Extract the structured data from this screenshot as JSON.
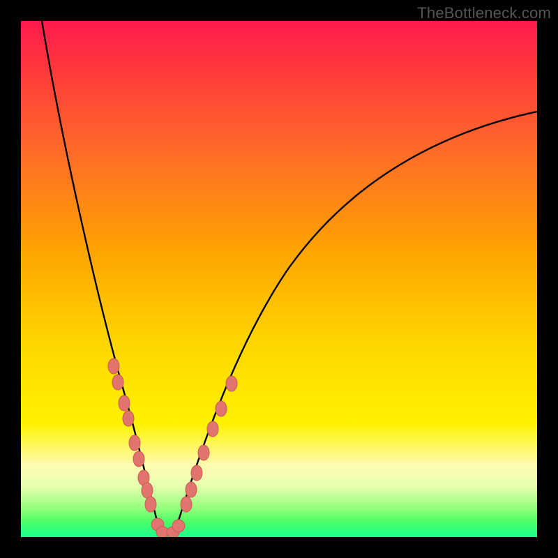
{
  "watermark": "TheBottleneck.com",
  "colors": {
    "background": "#000000",
    "gradient_top": "#ff1a4d",
    "gradient_bottom": "#1aff8c",
    "curve": "#000000",
    "marker_fill": "#e2746e",
    "marker_stroke": "#b84a44"
  },
  "chart_data": {
    "type": "line",
    "title": "",
    "xlabel": "",
    "ylabel": "",
    "xlim": [
      0,
      100
    ],
    "ylim": [
      0,
      100
    ],
    "grid": false,
    "legend": false,
    "note": "Axes are unlabeled; values are normalized 0–100. y is a bottleneck-percentage-like quantity (0 at bottom/green, 100 at top/red). The visible curve is V-shaped with its minimum near x≈27 at y≈0.",
    "series": [
      {
        "name": "left-branch",
        "x": [
          4,
          6,
          8,
          10,
          12,
          14,
          16,
          18,
          20,
          22,
          24,
          26,
          27
        ],
        "y": [
          100,
          90,
          78,
          66,
          55,
          45,
          36,
          28,
          20,
          13,
          7,
          2,
          0
        ]
      },
      {
        "name": "right-branch",
        "x": [
          27,
          30,
          34,
          38,
          42,
          46,
          50,
          55,
          60,
          65,
          70,
          75,
          80,
          85,
          90,
          95,
          100
        ],
        "y": [
          0,
          5,
          12,
          20,
          28,
          35,
          42,
          50,
          56,
          62,
          67,
          71,
          74,
          77,
          79,
          81,
          82
        ]
      }
    ],
    "markers": [
      {
        "branch": "left",
        "x": 17.0,
        "y": 31
      },
      {
        "branch": "left",
        "x": 17.8,
        "y": 28
      },
      {
        "branch": "left",
        "x": 19.0,
        "y": 24
      },
      {
        "branch": "left",
        "x": 19.8,
        "y": 21
      },
      {
        "branch": "left",
        "x": 21.0,
        "y": 16
      },
      {
        "branch": "left",
        "x": 21.8,
        "y": 13
      },
      {
        "branch": "left",
        "x": 22.8,
        "y": 10
      },
      {
        "branch": "left",
        "x": 23.5,
        "y": 8
      },
      {
        "branch": "left",
        "x": 24.2,
        "y": 6
      },
      {
        "branch": "left",
        "x": 25.5,
        "y": 2
      },
      {
        "branch": "left",
        "x": 26.5,
        "y": 1
      },
      {
        "branch": "left",
        "x": 28.5,
        "y": 1
      },
      {
        "branch": "left",
        "x": 29.5,
        "y": 2
      },
      {
        "branch": "right",
        "x": 31.0,
        "y": 6
      },
      {
        "branch": "right",
        "x": 32.0,
        "y": 9
      },
      {
        "branch": "right",
        "x": 33.0,
        "y": 12
      },
      {
        "branch": "right",
        "x": 34.3,
        "y": 16
      },
      {
        "branch": "right",
        "x": 36.0,
        "y": 21
      },
      {
        "branch": "right",
        "x": 37.5,
        "y": 25
      },
      {
        "branch": "right",
        "x": 39.5,
        "y": 30
      }
    ]
  }
}
